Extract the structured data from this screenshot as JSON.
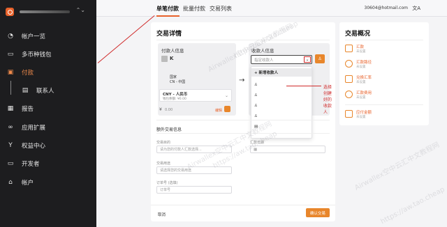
{
  "sidebar": {
    "caret": "⌃⌄",
    "items": [
      {
        "label": "帐户一览",
        "icon": "dashboard-icon"
      },
      {
        "label": "多币种钱包",
        "icon": "wallet-icon"
      },
      {
        "label": "付款",
        "icon": "payment-icon"
      },
      {
        "label": "联系人",
        "icon": "contacts-icon"
      },
      {
        "label": "报告",
        "icon": "report-icon"
      },
      {
        "label": "应用扩展",
        "icon": "link-icon"
      },
      {
        "label": "权益中心",
        "icon": "trophy-icon"
      },
      {
        "label": "开发者",
        "icon": "monitor-icon"
      },
      {
        "label": "帐户",
        "icon": "building-icon"
      }
    ]
  },
  "topbar": {
    "tabs": [
      "单笔付款",
      "批量付款",
      "交易列表"
    ],
    "email": "30604@hotmail.com",
    "lang_icon": "文A"
  },
  "details": {
    "title": "交易详情",
    "sender": {
      "title": "付款人信息",
      "name": "K",
      "country_label": "国家",
      "country": "CN - 中国",
      "currency": "CNY - 人民币",
      "balance": "钱包余额: ¥0.00",
      "amount_symbol": "¥",
      "amount": "0.00",
      "edit": "编辑"
    },
    "receiver": {
      "title": "收款人信息",
      "placeholder": "指定收款人",
      "add": "+ 新增收款人"
    },
    "annotation": "选择创建好的收款人",
    "extra": {
      "title": "额外交易信息",
      "reason_label": "交易目的",
      "reason_ph": "请为您的付款人汇款选择...",
      "date_label": "汇款日期",
      "memo_label": "交易用途",
      "memo_ph": "请选择您的交易用途",
      "order_label": "订单号 (选填)",
      "order_ph": "订单号"
    },
    "cancel": "取消",
    "confirm": "确认交易"
  },
  "overview": {
    "title": "交易概况",
    "items": [
      {
        "label": "汇款",
        "sub": "未设置"
      },
      {
        "label": "汇款路径",
        "sub": "未设置"
      },
      {
        "label": "兑换汇率",
        "sub": "未设置"
      },
      {
        "label": "汇款费用",
        "sub": "未设置"
      },
      {
        "label": "应付金额",
        "sub": "未设置"
      }
    ]
  },
  "watermarks": [
    "Airwallex空中云汇中文教程网",
    "https://aw.tao.cheap",
    "Airwallex空中云汇中文教程网",
    "https://aw.tao.cheap",
    "Airwallex空中云汇中文教程网",
    "https://aw.tao.cheap"
  ]
}
